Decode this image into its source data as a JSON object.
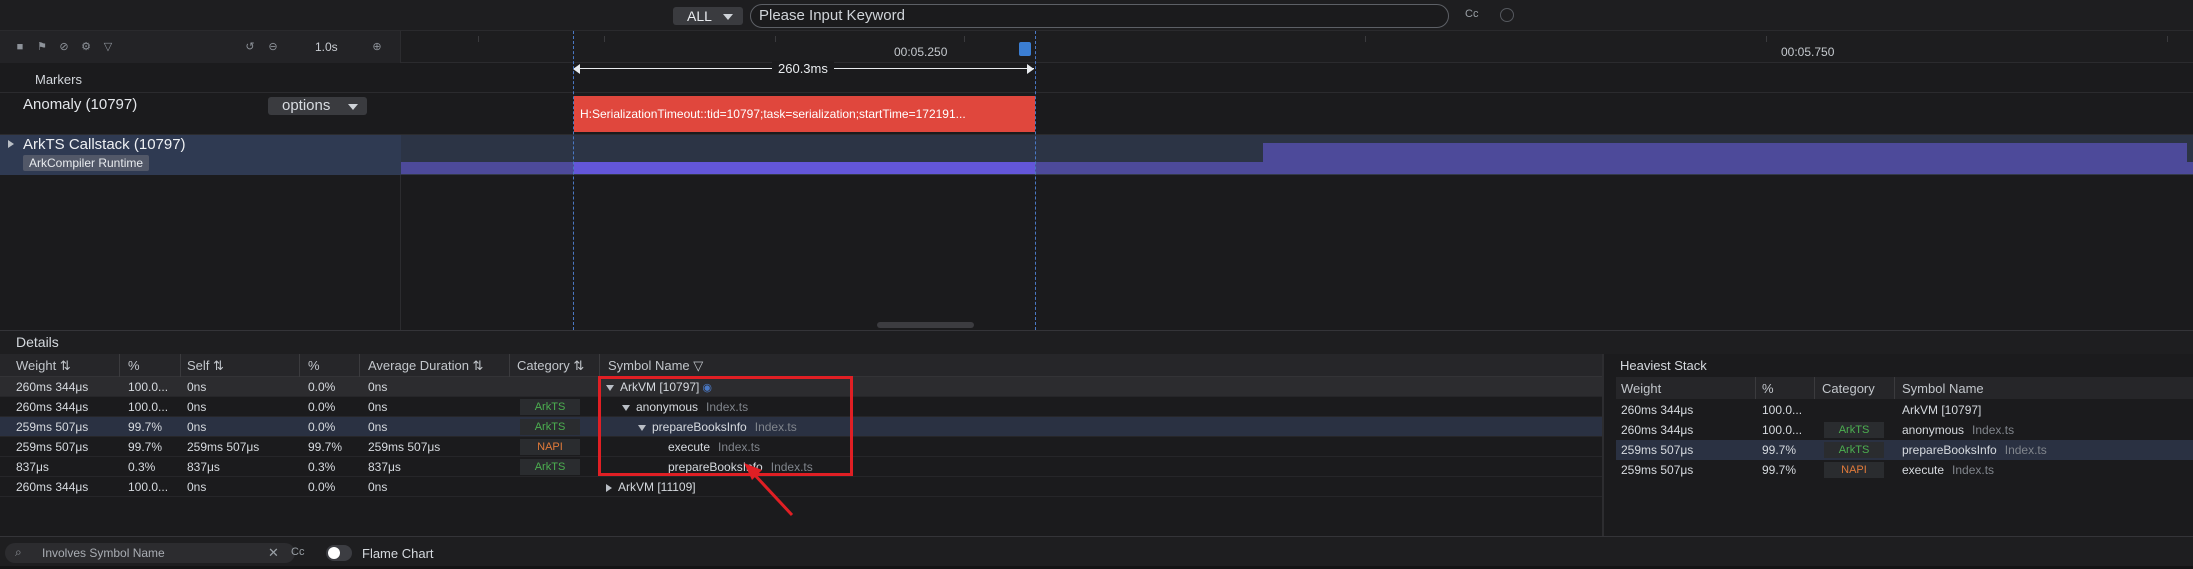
{
  "topbar": {
    "filter_label": "ALL",
    "search_placeholder": "Please Input Keyword",
    "case_label": "Cc"
  },
  "toolbar": {
    "zoom_label": "1.0s"
  },
  "timeline": {
    "time_labels": [
      "00:05.250",
      "00:05.750"
    ],
    "measure_label": "260.3ms"
  },
  "tracks": {
    "markers_label": "Markers",
    "anomaly_label": "Anomaly (10797)",
    "options_label": "options",
    "anomaly_event": "H:SerializationTimeout::tid=10797;task=serialization;startTime=172191...",
    "arkts_label": "ArkTS Callstack (10797)",
    "arkts_badge": "ArkCompiler Runtime"
  },
  "details": {
    "title": "Details",
    "columns": [
      "Weight",
      "%",
      "Self",
      "%",
      "Average Duration",
      "Category",
      "Symbol Name"
    ],
    "rows": [
      {
        "weight": "260ms 344μs",
        "pct": "100.0...",
        "self": "0ns",
        "self_pct": "0.0%",
        "avg": "0ns",
        "category": "",
        "symbol": "ArkVM [10797]",
        "file": ""
      },
      {
        "weight": "260ms 344μs",
        "pct": "100.0...",
        "self": "0ns",
        "self_pct": "0.0%",
        "avg": "0ns",
        "category": "ArkTS",
        "symbol": "anonymous",
        "file": "Index.ts"
      },
      {
        "weight": "259ms 507μs",
        "pct": "99.7%",
        "self": "0ns",
        "self_pct": "0.0%",
        "avg": "0ns",
        "category": "ArkTS",
        "symbol": "prepareBooksInfo",
        "file": "Index.ts"
      },
      {
        "weight": "259ms 507μs",
        "pct": "99.7%",
        "self": "259ms 507μs",
        "self_pct": "99.7%",
        "avg": "259ms 507μs",
        "category": "NAPI",
        "symbol": "execute",
        "file": "Index.ts"
      },
      {
        "weight": "837μs",
        "pct": "0.3%",
        "self": "837μs",
        "self_pct": "0.3%",
        "avg": "837μs",
        "category": "ArkTS",
        "symbol": "prepareBooksInfo",
        "file": "Index.ts"
      },
      {
        "weight": "260ms 344μs",
        "pct": "100.0...",
        "self": "0ns",
        "self_pct": "0.0%",
        "avg": "0ns",
        "category": "",
        "symbol": "ArkVM [11109]",
        "file": ""
      }
    ]
  },
  "heaviest": {
    "title": "Heaviest Stack",
    "columns": [
      "Weight",
      "%",
      "Category",
      "Symbol Name"
    ],
    "rows": [
      {
        "weight": "260ms 344μs",
        "pct": "100.0...",
        "category": "",
        "symbol": "ArkVM [10797]",
        "file": ""
      },
      {
        "weight": "260ms 344μs",
        "pct": "100.0...",
        "category": "ArkTS",
        "symbol": "anonymous",
        "file": "Index.ts"
      },
      {
        "weight": "259ms 507μs",
        "pct": "99.7%",
        "category": "ArkTS",
        "symbol": "prepareBooksInfo",
        "file": "Index.ts"
      },
      {
        "weight": "259ms 507μs",
        "pct": "99.7%",
        "category": "NAPI",
        "symbol": "execute",
        "file": "Index.ts"
      }
    ]
  },
  "bottombar": {
    "search_placeholder": "Involves Symbol Name",
    "case_label": "Cc",
    "flame_label": "Flame Chart"
  },
  "colors": {
    "arkts": "#4caf50",
    "napi": "#e07a3a",
    "anomaly": "#e0473d",
    "highlight": "#e01f24"
  }
}
